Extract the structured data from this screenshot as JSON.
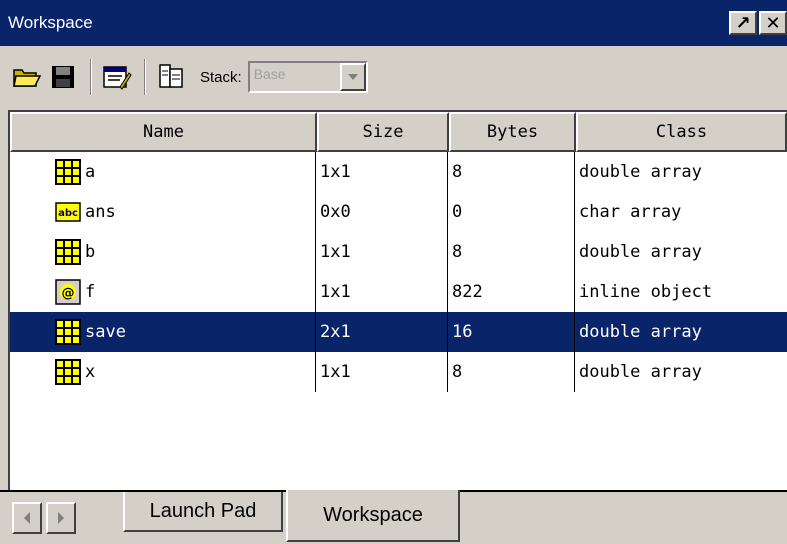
{
  "window": {
    "title": "Workspace",
    "undock_glyph": "↗",
    "close_glyph": "✕"
  },
  "toolbar": {
    "icons": [
      "open-folder-icon",
      "save-disk-icon",
      "edit-variable-icon",
      "delete-variable-icon"
    ],
    "stack_label": "Stack:",
    "stack_value": "Base"
  },
  "table": {
    "columns": [
      "Name",
      "Size",
      "Bytes",
      "Class"
    ],
    "rows": [
      {
        "icon": "matrix-icon",
        "name": "a",
        "size": "1x1",
        "bytes": "8",
        "class": "double array",
        "selected": false
      },
      {
        "icon": "char-array-icon",
        "name": "ans",
        "size": "0x0",
        "bytes": "0",
        "class": "char array",
        "selected": false
      },
      {
        "icon": "matrix-icon",
        "name": "b",
        "size": "1x1",
        "bytes": "8",
        "class": "double array",
        "selected": false
      },
      {
        "icon": "inline-object-icon",
        "name": "f",
        "size": "1x1",
        "bytes": "822",
        "class": "inline object",
        "selected": false
      },
      {
        "icon": "matrix-icon",
        "name": "save",
        "size": "2x1",
        "bytes": "16",
        "class": "double array",
        "selected": true
      },
      {
        "icon": "matrix-icon",
        "name": "x",
        "size": "1x1",
        "bytes": "8",
        "class": "double array",
        "selected": false
      }
    ]
  },
  "tabs": [
    {
      "label": "Launch Pad",
      "active": false
    },
    {
      "label": "Workspace",
      "active": true
    }
  ],
  "colors": {
    "titlebar": "#0a246a",
    "selection": "#0a246a",
    "chrome": "#d4d0c8",
    "matrix_icon": "#ffff00"
  }
}
